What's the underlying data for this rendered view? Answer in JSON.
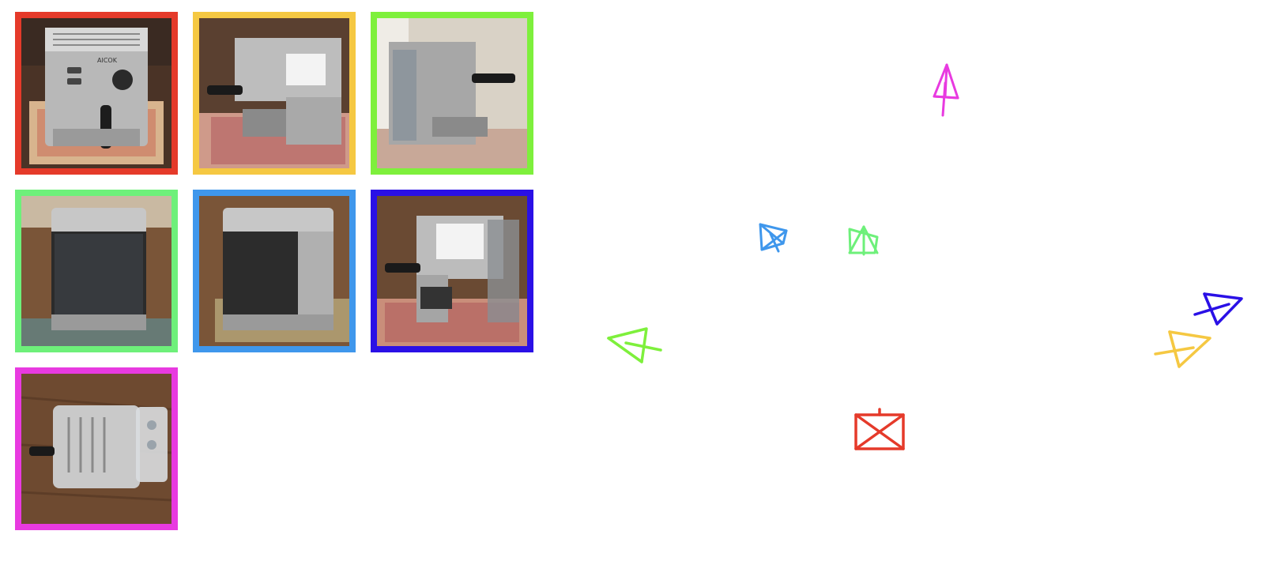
{
  "views": [
    {
      "id": "front",
      "color": "#e53a2a",
      "photo": "espresso-machine-front-photo",
      "camera": "front-camera-icon"
    },
    {
      "id": "right-side",
      "color": "#f5c842",
      "photo": "espresso-machine-right-side-photo",
      "camera": "right-camera-icon"
    },
    {
      "id": "left-side",
      "color": "#7ef03c",
      "photo": "espresso-machine-left-side-photo",
      "camera": "left-camera-icon"
    },
    {
      "id": "back",
      "color": "#6ef07a",
      "photo": "espresso-machine-back-photo",
      "camera": "back-camera-icon"
    },
    {
      "id": "back-left",
      "color": "#3f97ec",
      "photo": "espresso-machine-back-left-photo",
      "camera": "back-left-camera-icon"
    },
    {
      "id": "right-back",
      "color": "#2a10e6",
      "photo": "espresso-machine-right-back-photo",
      "camera": "right-back-camera-icon"
    },
    {
      "id": "top",
      "color": "#e83ae0",
      "photo": "espresso-machine-top-photo",
      "camera": "top-camera-icon"
    }
  ],
  "logo_text": "AICOK"
}
